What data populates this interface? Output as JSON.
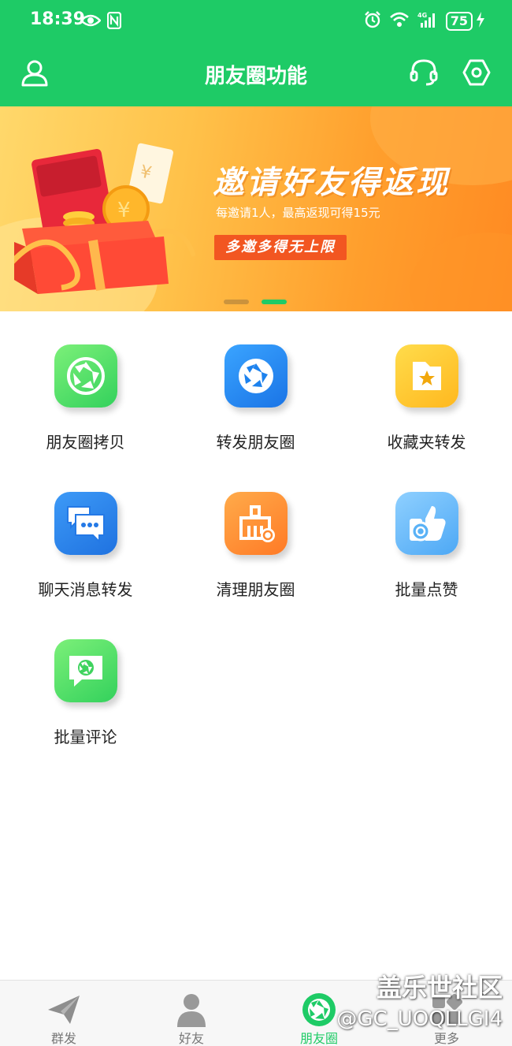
{
  "status": {
    "time": "18:39",
    "battery": "75",
    "network": "4G"
  },
  "header": {
    "title": "朋友圈功能"
  },
  "banner": {
    "headline": "邀请好友得返现",
    "subtitle": "每邀请1人，最高返现可得15元",
    "tag": "多邀多得无上限",
    "page_count": 2,
    "active_index": 1
  },
  "features": [
    {
      "label": "朋友圈拷贝",
      "icon": "aperture-icon",
      "color": "#3fd35e"
    },
    {
      "label": "转发朋友圈",
      "icon": "aperture-icon",
      "color": "#1d82ee"
    },
    {
      "label": "收藏夹转发",
      "icon": "star-folder-icon",
      "color": "#ffc62c"
    },
    {
      "label": "聊天消息转发",
      "icon": "chat-bubbles-icon",
      "color": "#2479e6"
    },
    {
      "label": "清理朋友圈",
      "icon": "broom-icon",
      "color": "#ff8a30"
    },
    {
      "label": "批量点赞",
      "icon": "thumbs-up-icon",
      "color": "#5ab2f6"
    },
    {
      "label": "批量评论",
      "icon": "comment-aperture-icon",
      "color": "#3fd35e"
    }
  ],
  "bottom_nav": {
    "tabs": [
      {
        "label": "群发",
        "icon": "paper-plane-icon",
        "active": false
      },
      {
        "label": "好友",
        "icon": "person-icon",
        "active": false
      },
      {
        "label": "朋友圈",
        "icon": "aperture-icon",
        "active": true
      },
      {
        "label": "更多",
        "icon": "grid-icon",
        "active": false
      }
    ]
  },
  "watermark": {
    "line1": "盖乐世社区",
    "line2": "@GC_UOQLLGI4"
  },
  "colors": {
    "brand": "#1ecb66",
    "banner": "#ffb13a",
    "tag": "#f25621"
  }
}
